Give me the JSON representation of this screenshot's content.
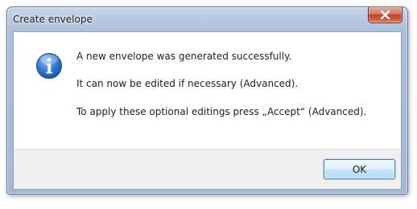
{
  "window": {
    "title": "Create envelope"
  },
  "icon": {
    "name": "info-icon",
    "color": "#2a6fc9"
  },
  "message": {
    "line1": "A new envelope was generated successfully.",
    "line2": "It can now be edited if necessary (Advanced).",
    "line3": "To apply these optional editings press „Accept“ (Advanced)."
  },
  "buttons": {
    "ok_label": "OK",
    "close_icon": "close-icon"
  },
  "colors": {
    "close_button": "#c8452c",
    "ok_border": "#3c7fb1",
    "footer_bg": "#f0f0f0"
  }
}
